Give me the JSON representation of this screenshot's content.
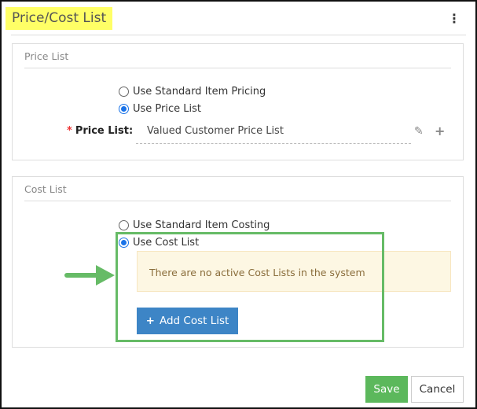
{
  "header": {
    "title": "Price/Cost List",
    "menu_icon": "kebab-menu-icon",
    "highlight_color": "#ffff66"
  },
  "price_list": {
    "section_title": "Price List",
    "options": [
      {
        "label": "Use Standard Item Pricing",
        "selected": false
      },
      {
        "label": "Use Price List",
        "selected": true
      }
    ],
    "field_label": "Price List:",
    "required_mark": "*",
    "field_value": "Valued Customer Price List",
    "icons": [
      "edit-icon",
      "plus-icon"
    ]
  },
  "cost_list": {
    "section_title": "Cost List",
    "options": [
      {
        "label": "Use Standard Item Costing",
        "selected": false
      },
      {
        "label": "Use Cost List",
        "selected": true
      }
    ],
    "notice": "There are no active Cost Lists in the system",
    "add_button": "Add Cost List",
    "add_icon": "+"
  },
  "annotation": {
    "color": "#66bb66"
  },
  "footer": {
    "save": "Save",
    "cancel": "Cancel"
  }
}
